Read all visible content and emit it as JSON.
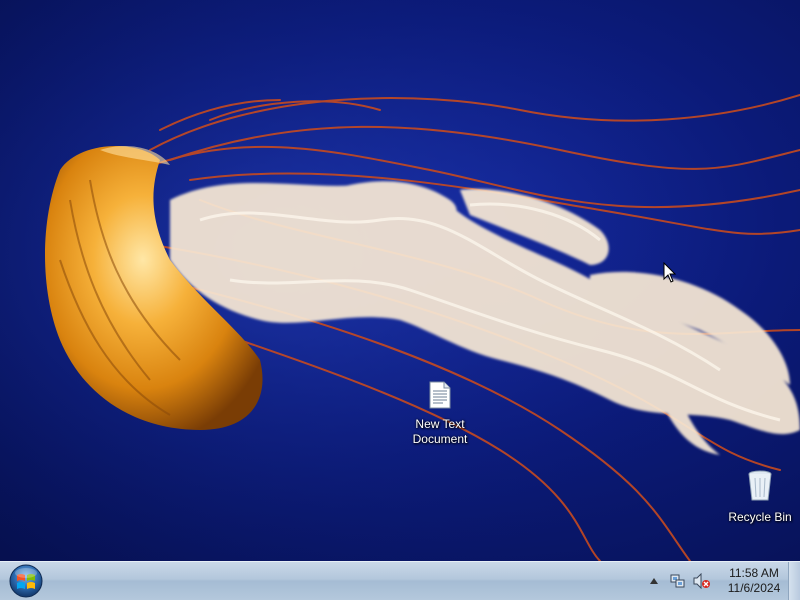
{
  "desktop": {
    "wallpaper": "jellyfish-wallpaper",
    "background_color": "#0b1a78",
    "icons": [
      {
        "label": "New Text Document",
        "icon": "text-document-icon"
      },
      {
        "label": "Recycle Bin",
        "icon": "recycle-bin-icon"
      }
    ]
  },
  "taskbar": {
    "start_button": {
      "icon": "windows-logo-icon"
    },
    "tray": {
      "icons": [
        "show-hidden-icons-arrow",
        "network-icon",
        "volume-muted-icon"
      ],
      "clock": {
        "time": "11:58 AM",
        "date": "11/6/2024"
      }
    }
  }
}
